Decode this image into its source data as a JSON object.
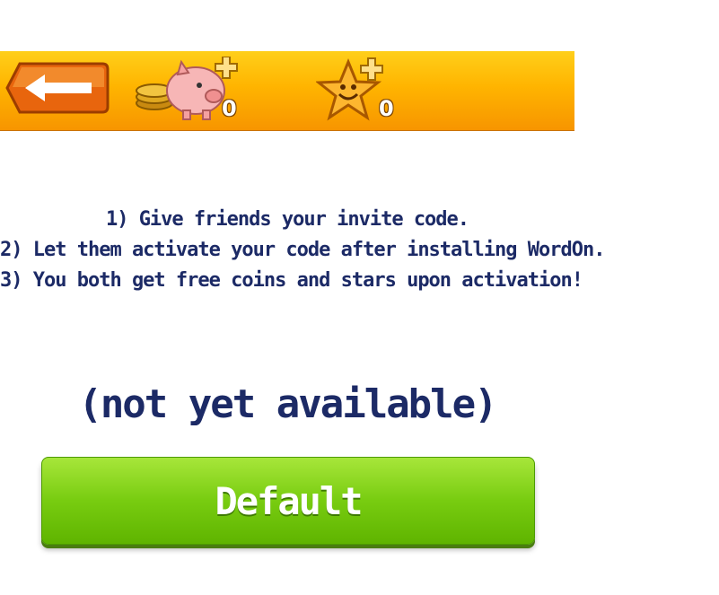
{
  "header": {
    "back_icon": "left-arrow-icon",
    "coins": {
      "icon": "piggy-bank-icon",
      "add_icon": "plus-icon",
      "count": "0"
    },
    "stars": {
      "icon": "smiling-star-icon",
      "add_icon": "plus-icon",
      "count": "0"
    },
    "colors": {
      "bar": "#ffb400",
      "back_button": "#f07a12"
    }
  },
  "instructions": {
    "line1": "1) Give friends your invite code.",
    "line2": "2) Let them activate your code after installing WordOn.",
    "line3": "3) You both get free coins and stars upon activation!"
  },
  "invite": {
    "status": "(not yet available)"
  },
  "action": {
    "button_label": "Default",
    "color": "#78cc10"
  }
}
